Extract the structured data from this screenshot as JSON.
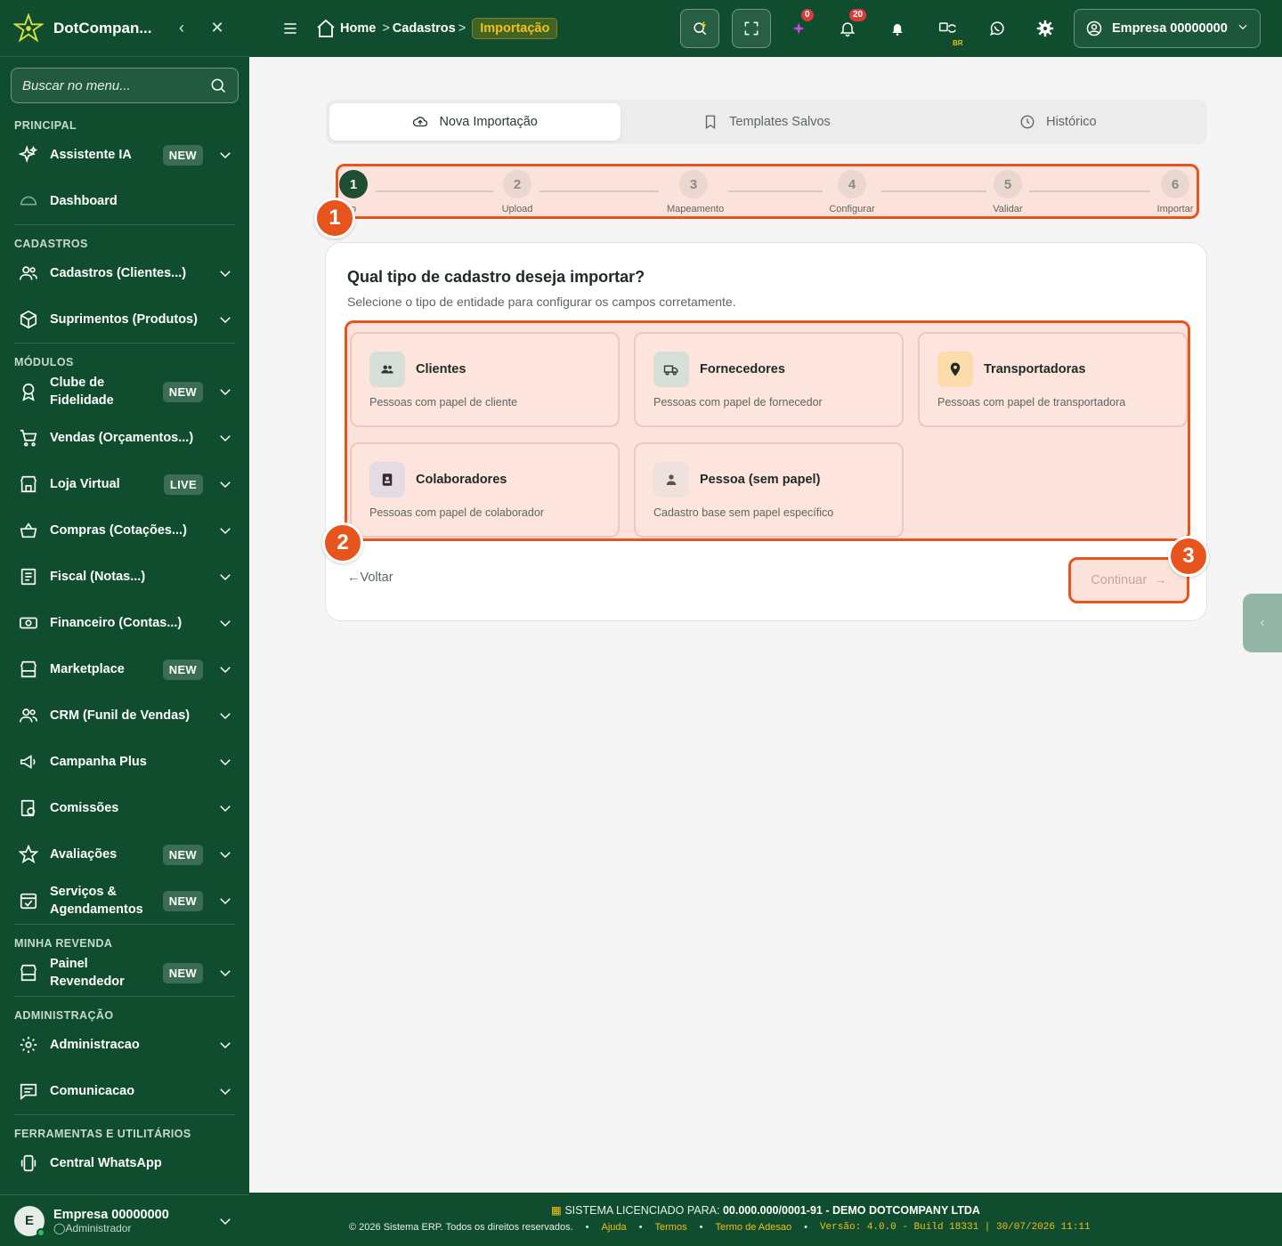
{
  "sidebar": {
    "brand": "DotCompan...",
    "search_placeholder": "Buscar no menu...",
    "sections": {
      "principal": "PRINCIPAL",
      "cadastros": "CADASTROS",
      "modulos": "MÓDULOS",
      "revenda": "MINHA REVENDA",
      "admin": "ADMINISTRAÇÃO",
      "ferramentas": "FERRAMENTAS E UTILITÁRIOS"
    },
    "items": {
      "assistente": {
        "label": "Assistente IA",
        "badge": "NEW"
      },
      "dashboard": {
        "label": "Dashboard"
      },
      "cadastros": {
        "label": "Cadastros (Clientes...)"
      },
      "suprimentos": {
        "label": "Suprimentos (Produtos)"
      },
      "clube": {
        "label": "Clube de Fidelidade",
        "badge": "NEW"
      },
      "vendas": {
        "label": "Vendas (Orçamentos...)"
      },
      "loja": {
        "label": "Loja Virtual",
        "badge": "LIVE"
      },
      "compras": {
        "label": "Compras (Cotações...)"
      },
      "fiscal": {
        "label": "Fiscal (Notas...)"
      },
      "financeiro": {
        "label": "Financeiro (Contas...)"
      },
      "marketplace": {
        "label": "Marketplace",
        "badge": "NEW"
      },
      "crm": {
        "label": "CRM (Funil de Vendas)"
      },
      "campanha": {
        "label": "Campanha Plus"
      },
      "comissoes": {
        "label": "Comissões"
      },
      "avaliacoes": {
        "label": "Avaliações",
        "badge": "NEW"
      },
      "servicos": {
        "label": "Serviços & Agendamentos",
        "badge": "NEW"
      },
      "painel": {
        "label": "Painel Revendedor",
        "badge": "NEW"
      },
      "administracao": {
        "label": "Administracao"
      },
      "comunicacao": {
        "label": "Comunicacao"
      },
      "whatsapp": {
        "label": "Central WhatsApp"
      }
    },
    "user": {
      "initial": "E",
      "name": "Empresa 00000000",
      "role": "Administrador"
    }
  },
  "topbar": {
    "breadcrumb": {
      "home": "Home",
      "cadastros": "Cadastros",
      "current": "Importação"
    },
    "sparkle_count": "0",
    "notif_count": "20",
    "lang_badge": "BR",
    "company": "Empresa 00000000"
  },
  "tabs": [
    {
      "label": "Nova Importação"
    },
    {
      "label": "Templates Salvos"
    },
    {
      "label": "Histórico"
    }
  ],
  "steps": [
    {
      "num": "1",
      "label": "o"
    },
    {
      "num": "2",
      "label": "Upload"
    },
    {
      "num": "3",
      "label": "Mapeamento"
    },
    {
      "num": "4",
      "label": "Configurar"
    },
    {
      "num": "5",
      "label": "Validar"
    },
    {
      "num": "6",
      "label": "Importar"
    }
  ],
  "markers": [
    "1",
    "2",
    "3"
  ],
  "card": {
    "title": "Qual tipo de cadastro deseja importar?",
    "subtitle": "Selecione o tipo de entidade para configurar os campos corretamente.",
    "options": [
      {
        "title": "Clientes",
        "desc": "Pessoas com papel de cliente",
        "icon": "users-icon",
        "bg": "#d8dfd6"
      },
      {
        "title": "Fornecedores",
        "desc": "Pessoas com papel de fornecedor",
        "icon": "truck-icon",
        "bg": "#d8dfd6"
      },
      {
        "title": "Transportadoras",
        "desc": "Pessoas com papel de transportadora",
        "icon": "map-pin-icon",
        "bg": "#fcdcaa"
      },
      {
        "title": "Colaboradores",
        "desc": "Pessoas com papel de colaborador",
        "icon": "id-badge-icon",
        "bg": "#e5dce3"
      },
      {
        "title": "Pessoa (sem papel)",
        "desc": "Cadastro base sem papel específico",
        "icon": "user-icon",
        "bg": "#efe2dd"
      }
    ],
    "back": "Voltar",
    "continue": "Continuar"
  },
  "footer": {
    "license_prefix": "SISTEMA LICENCIADO PARA:",
    "license_value": "00.000.000/0001-91 - DEMO DOTCOMPANY LTDA",
    "copyright": "© 2026 Sistema ERP. Todos os direitos reservados.",
    "help": "Ajuda",
    "terms": "Termos",
    "adhesion": "Termo de Adesao",
    "version": "Versão: 4.0.0 - Build 18331 | 30/07/2026 11:11"
  },
  "colors": {
    "brand_green": "#0f4d2e",
    "accent_orange": "#e8541e",
    "accent_yellow": "#f3bf1a"
  }
}
